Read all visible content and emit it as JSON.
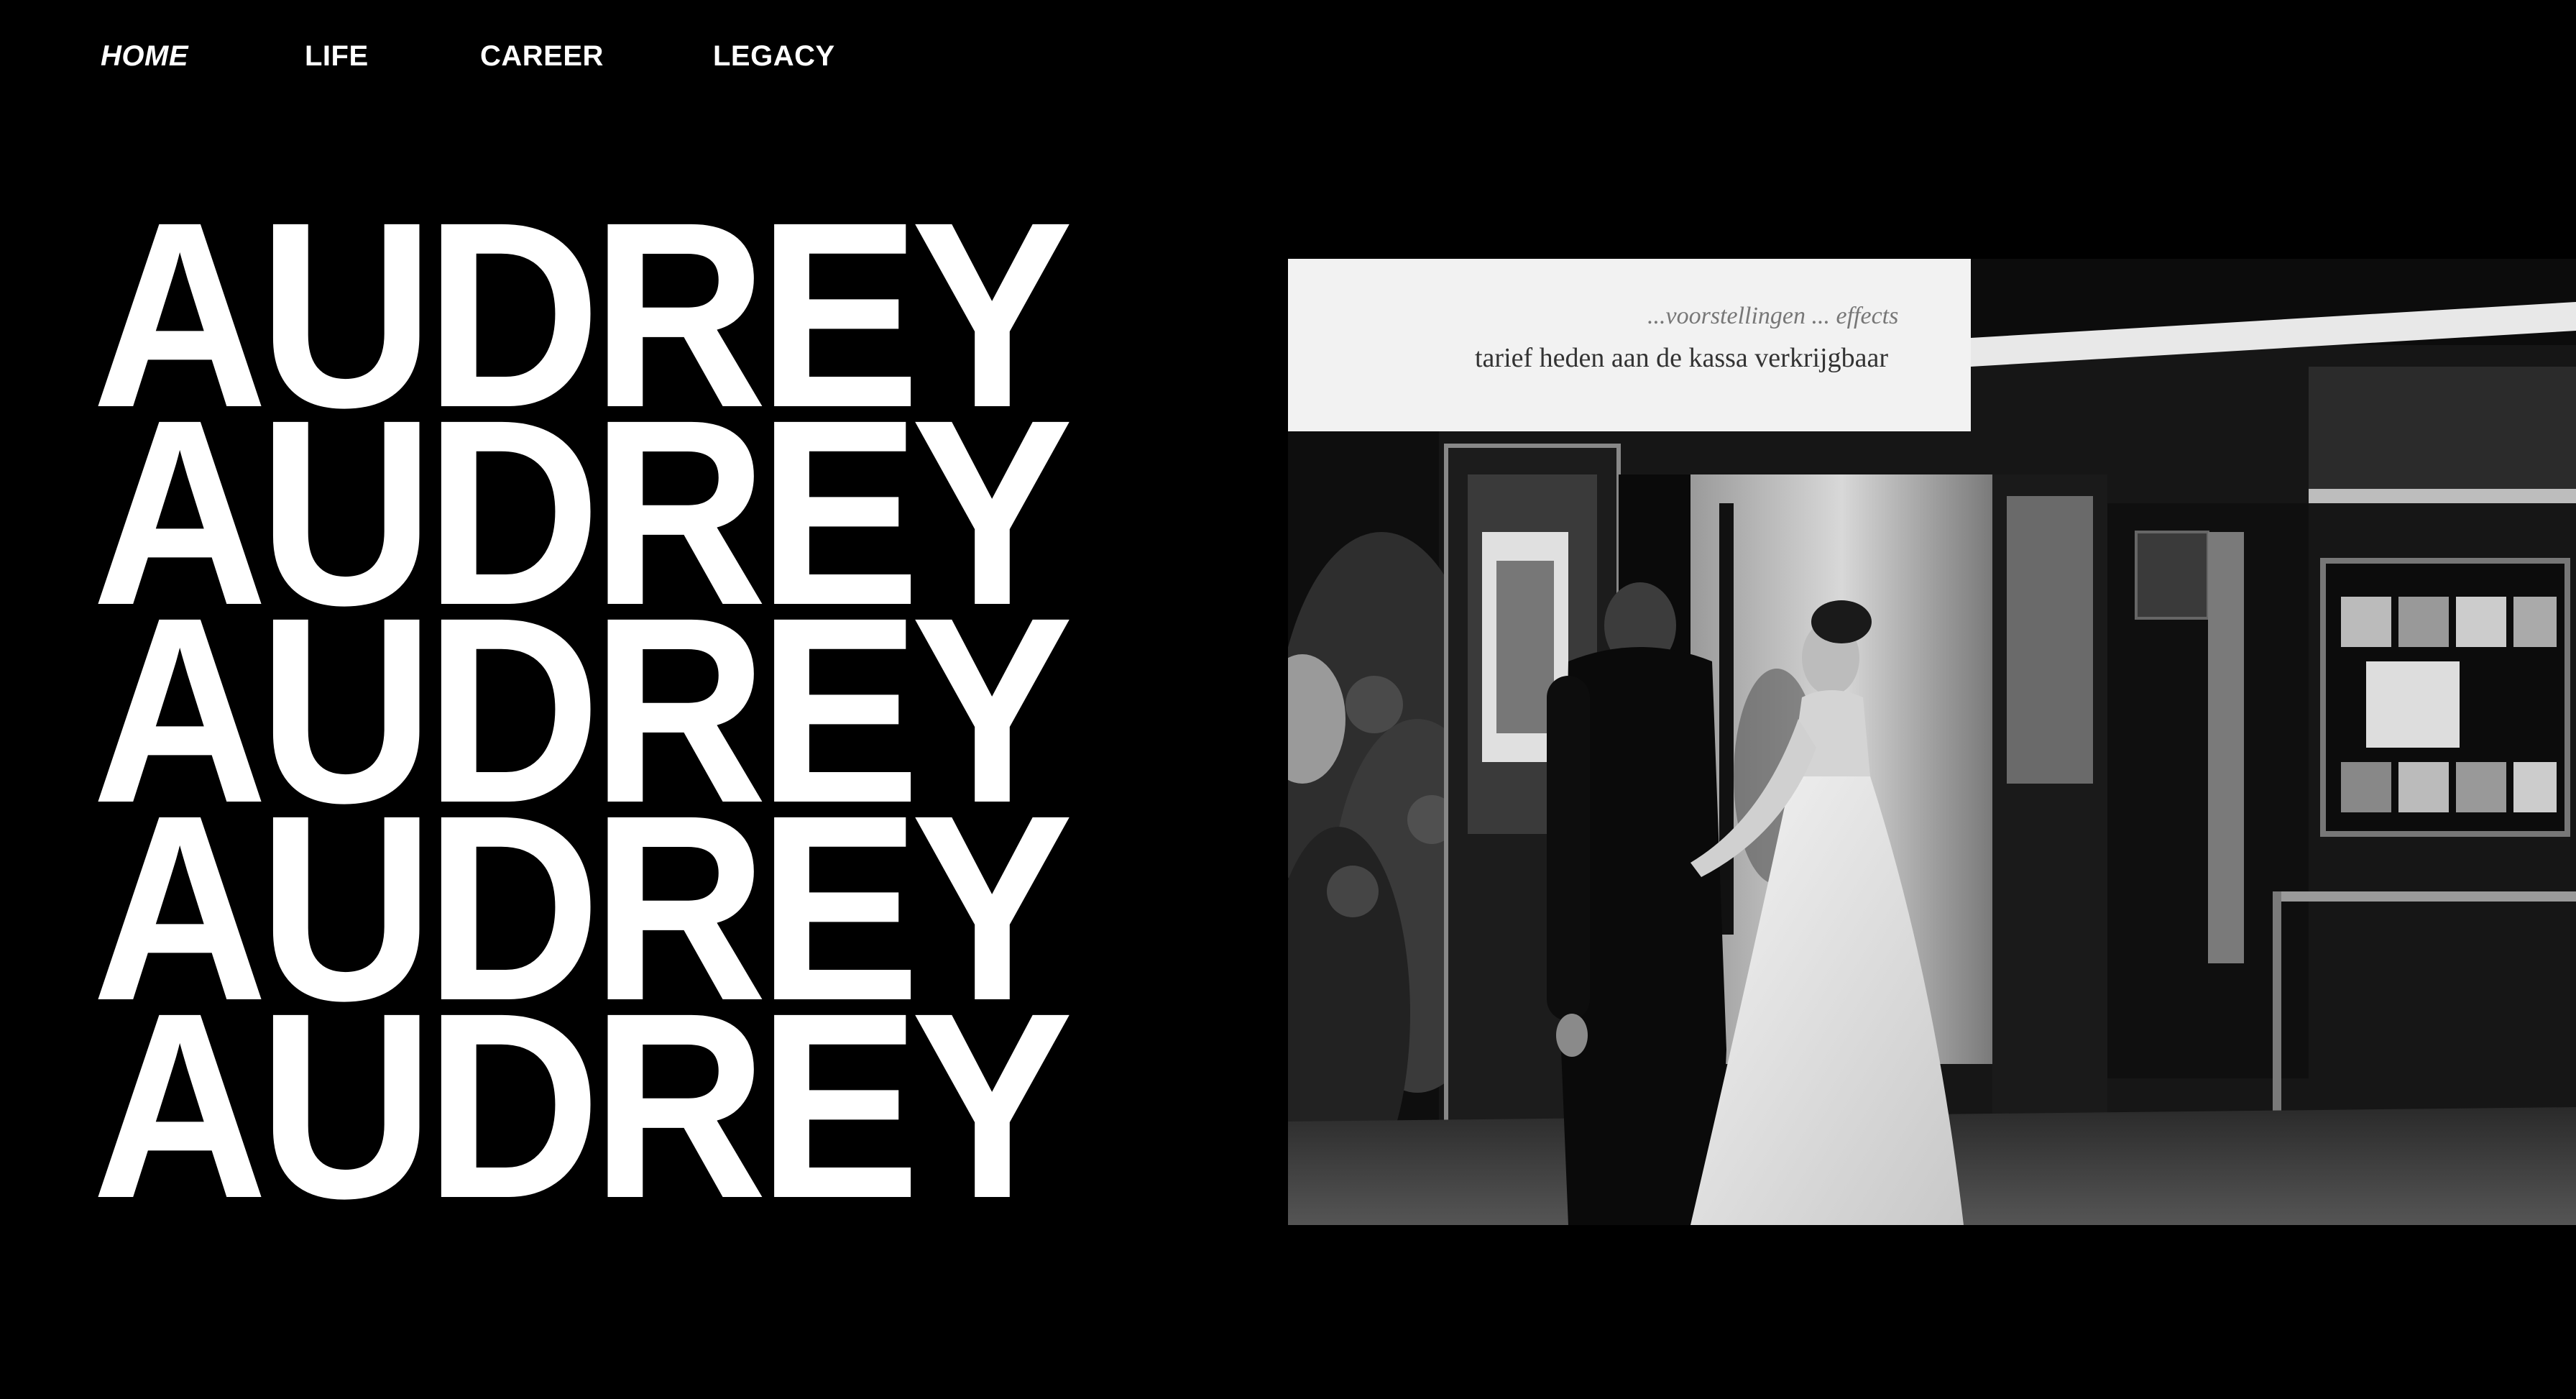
{
  "nav": {
    "items": [
      {
        "label": "HOME",
        "active": true
      },
      {
        "label": "LIFE",
        "active": false
      },
      {
        "label": "CAREER",
        "active": false
      },
      {
        "label": "LEGACY",
        "active": false
      }
    ]
  },
  "hero": {
    "lines": [
      "AUDREY",
      "AUDREY",
      "AUDREY",
      "AUDREY",
      "AUDREY"
    ]
  },
  "photo": {
    "sign_text": "tarief heden aan de kassa verkrijgbaar",
    "sign_text_small": "...voorstellingen ... effects"
  },
  "colors": {
    "background": "#000000",
    "text": "#ffffff"
  }
}
